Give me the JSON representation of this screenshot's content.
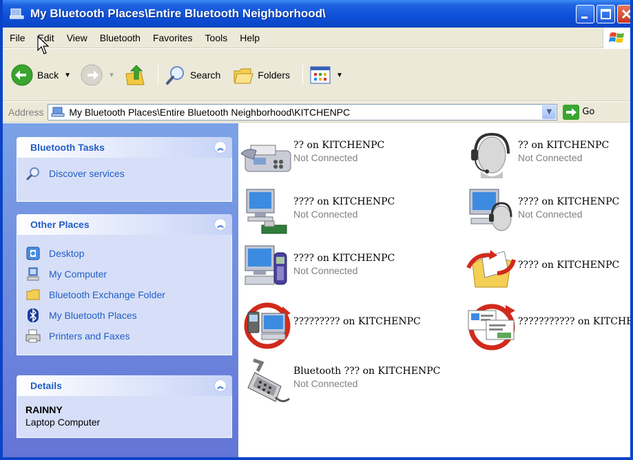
{
  "window": {
    "title": "My Bluetooth Places\\Entire Bluetooth Neighborhood\\"
  },
  "menu": [
    "File",
    "Edit",
    "View",
    "Bluetooth",
    "Favorites",
    "Tools",
    "Help"
  ],
  "toolbar": {
    "back_label": "Back",
    "search_label": "Search",
    "folders_label": "Folders"
  },
  "address": {
    "label": "Address",
    "value": "My Bluetooth Places\\Entire Bluetooth Neighborhood\\KITCHENPC",
    "go_label": "Go"
  },
  "left_pane": {
    "bluetooth_tasks": {
      "title": "Bluetooth Tasks",
      "items": [
        {
          "label": "Discover services",
          "icon": "search-icon"
        }
      ]
    },
    "other_places": {
      "title": "Other Places",
      "items": [
        {
          "label": "Desktop",
          "icon": "desktop-icon"
        },
        {
          "label": "My Computer",
          "icon": "computer-icon"
        },
        {
          "label": "Bluetooth Exchange Folder",
          "icon": "folder-icon"
        },
        {
          "label": "My Bluetooth Places",
          "icon": "bluetooth-icon"
        },
        {
          "label": "Printers and Faxes",
          "icon": "printer-icon"
        }
      ]
    },
    "details": {
      "title": "Details",
      "name": "RAINNY",
      "type": "Laptop Computer"
    }
  },
  "services": [
    {
      "name": "?? on KITCHENPC",
      "status": "Not Connected",
      "icon": "fax-icon"
    },
    {
      "name": "?? on KITCHENPC",
      "status": "Not Connected",
      "icon": "headset-icon"
    },
    {
      "name": "???? on KITCHENPC",
      "status": "Not Connected",
      "icon": "network-computer-icon"
    },
    {
      "name": "???? on KITCHENPC",
      "status": "Not Connected",
      "icon": "computer-headset-icon"
    },
    {
      "name": "???? on KITCHENPC",
      "status": "Not Connected",
      "icon": "computer-phone-icon"
    },
    {
      "name": "???? on KITCHENPC",
      "status": "",
      "icon": "folder-transfer-icon"
    },
    {
      "name": "????????? on KITCHENPC",
      "status": "",
      "icon": "sync-computer-icon"
    },
    {
      "name": "??????????? on KITCHENPC",
      "status": "",
      "icon": "business-card-icon"
    },
    {
      "name": "Bluetooth ??? on KITCHENPC",
      "status": "Not Connected",
      "icon": "serial-port-icon"
    }
  ],
  "colors": {
    "titlebar": "#0d4fd8",
    "task_link": "#215dc6",
    "status_gray": "#808080"
  }
}
